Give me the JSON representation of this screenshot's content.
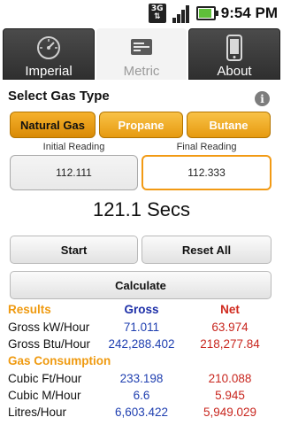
{
  "status_bar": {
    "network": "3G",
    "time": "9:54",
    "time_suffix": "PM"
  },
  "tabs": [
    {
      "label": "Imperial",
      "icon": "gauge-icon"
    },
    {
      "label": "Metric",
      "icon": "card-icon"
    },
    {
      "label": "About",
      "icon": "phone-icon"
    }
  ],
  "active_tab": "Metric",
  "gas_type": {
    "title": "Select Gas Type",
    "options": [
      "Natural Gas",
      "Propane",
      "Butane"
    ],
    "selected": "Natural Gas"
  },
  "readings": {
    "initial_label": "Initial Reading",
    "initial_value": "112.111",
    "final_label": "Final Reading",
    "final_value": "112.333"
  },
  "timer": "121.1 Secs",
  "actions": {
    "start": "Start",
    "reset": "Reset All",
    "calculate": "Calculate"
  },
  "results": {
    "header": [
      "Results",
      "Gross",
      "Net"
    ],
    "rows": [
      {
        "label": "Gross kW/Hour",
        "gross": "71.011",
        "net": "63.974"
      },
      {
        "label": "Gross Btu/Hour",
        "gross": "242,288.402",
        "net": "218,277.84"
      }
    ],
    "consumption_title": "Gas Consumption",
    "consumption_rows": [
      {
        "label": "Cubic Ft/Hour",
        "gross": "233.198",
        "net": "210.088"
      },
      {
        "label": "Cubic M/Hour",
        "gross": "6.6",
        "net": "5.945"
      },
      {
        "label": "Litres/Hour",
        "gross": "6,603.422",
        "net": "5,949.029"
      }
    ]
  },
  "colors": {
    "accent_orange": "#f0a020",
    "gross_blue": "#1f3fb0",
    "net_red": "#c8261e"
  }
}
